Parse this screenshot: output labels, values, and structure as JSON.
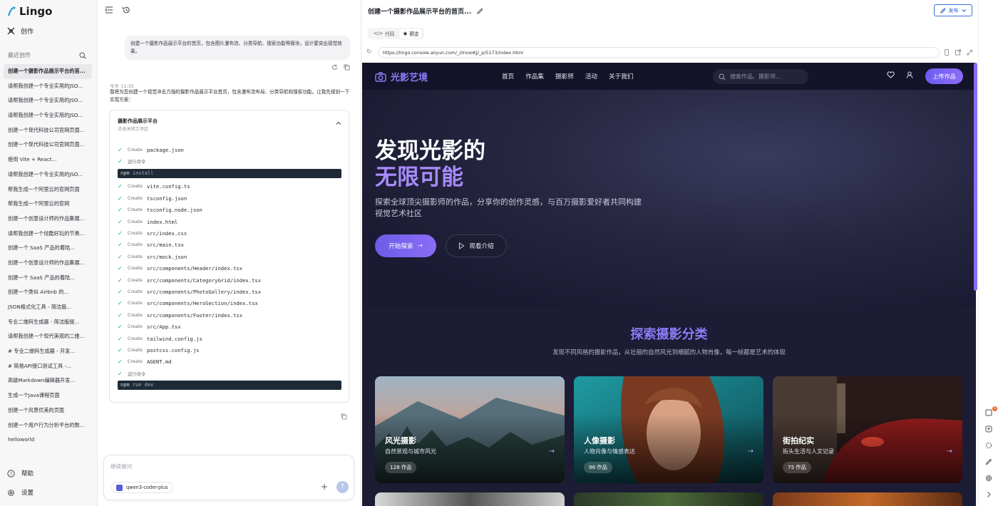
{
  "app": {
    "name": "Lingo"
  },
  "sidebar": {
    "create_label": "创作",
    "recent_label": "最近创作",
    "items": [
      "创建一个摄影作品展示平台的首...",
      "请帮我创建一个专业实用的JSO...",
      "请帮我创建一个专业实用的JSO...",
      "请帮我创建一个专业实用的JSO...",
      "创建一个现代科技公司官网页面...",
      "创建一个现代科技公司官网页面...",
      "使用 Vite + React...",
      "请帮我创建一个专业实用的JSO...",
      "帮我生成一个阿里云的官网页面",
      "帮我生成一个阿里云的官网",
      "创建一个创意设计师的作品集展...",
      "请帮我创建一个炫酷好玩的节奏...",
      "创建一个 SaaS 产品的着陆...",
      "创建一个创意设计师的作品集展...",
      "创建一个 SaaS 产品的着陆...",
      "创建一个类似 Airbnb 的...",
      "JSON格式化工具 - 简洁版...",
      "专业二维码生成器 - 简洁版提...",
      "请帮我创建一个现代美观的二维...",
      "# 专业二维码生成器 - 开发...",
      "# 简易API接口测试工具 -...",
      "高级Markdown编辑器开发...",
      "生成一个Java课程页面",
      "创建一个风景优美的页面",
      "创建一个用户行为分析平台的数...",
      "helloworld"
    ],
    "help_label": "帮助",
    "settings_label": "设置"
  },
  "chat": {
    "user_message": "创建一个摄影作品展示平台的首页，包含图片瀑布流、分类导航、搜索功能等模块，设计要突出视觉效果。",
    "time": "今天 11:35",
    "reply": "我将为您创建一个视觉冲击力强的摄影作品展示平台首页，包含瀑布流布局、分类导航和搜索功能。让我先规划一下实现方案：",
    "workspace_title": "摄影作品展示平台",
    "workspace_sub": "点击关闭工作区",
    "create_word": "Create",
    "run_label": "运行命令",
    "files_a": [
      "package.json"
    ],
    "cmd1_a": "npm",
    "cmd1_b": "install",
    "files_b": [
      "vite.config.ts",
      "tsconfig.json",
      "tsconfig.node.json",
      "index.html",
      "src/index.css",
      "src/main.tsx",
      "src/mock.json",
      "src/components/Header/index.tsx",
      "src/components/CategoryGrid/index.tsx",
      "src/components/PhotoGallery/index.tsx",
      "src/components/HeroSection/index.tsx",
      "src/components/Footer/index.tsx",
      "src/App.tsx",
      "tailwind.config.js",
      "postcss.config.js",
      "AGENT.md"
    ],
    "cmd2_a": "npm",
    "cmd2_b": "run dev",
    "composer_placeholder": "继续提问",
    "model": "qwen3-coder-plus"
  },
  "preview": {
    "title": "创建一个摄影作品展示平台的首页...",
    "publish_label": "发布",
    "tab_code": "代码",
    "tab_preview": "预览",
    "url": "https://lingo.console.aliyun.com/_i/lrxxoKJ/_p/5173/index.html"
  },
  "site": {
    "brand": "光影艺境",
    "nav": [
      "首页",
      "作品集",
      "摄影师",
      "活动",
      "关于我们"
    ],
    "search_placeholder": "搜索作品、摄影师...",
    "upload_label": "上传作品",
    "hero_line1": "发现光影的",
    "hero_line2": "无限可能",
    "hero_desc": "探索全球顶尖摄影师的作品，分享你的创作灵感，与百万摄影爱好者共同构建视觉艺术社区",
    "cta_primary": "开始探索",
    "cta_secondary": "观看介绍",
    "cat_title": "探索摄影分类",
    "cat_sub": "发现不同风格的摄影作品，从壮丽的自然风光到细腻的人物肖像，每一帧都是艺术的体现",
    "cards": [
      {
        "title": "风光摄影",
        "sub": "自然景观与城市风光",
        "count": "128 作品"
      },
      {
        "title": "人像摄影",
        "sub": "人物肖像与情感表达",
        "count": "96 作品"
      },
      {
        "title": "街拍纪实",
        "sub": "街头生活与人文记录",
        "count": "75 作品"
      }
    ]
  },
  "colors": {
    "accent": "#8b6cf6",
    "site_bg": "#1c1c34",
    "publish": "#2f5fc9"
  },
  "rail_badge": "1"
}
